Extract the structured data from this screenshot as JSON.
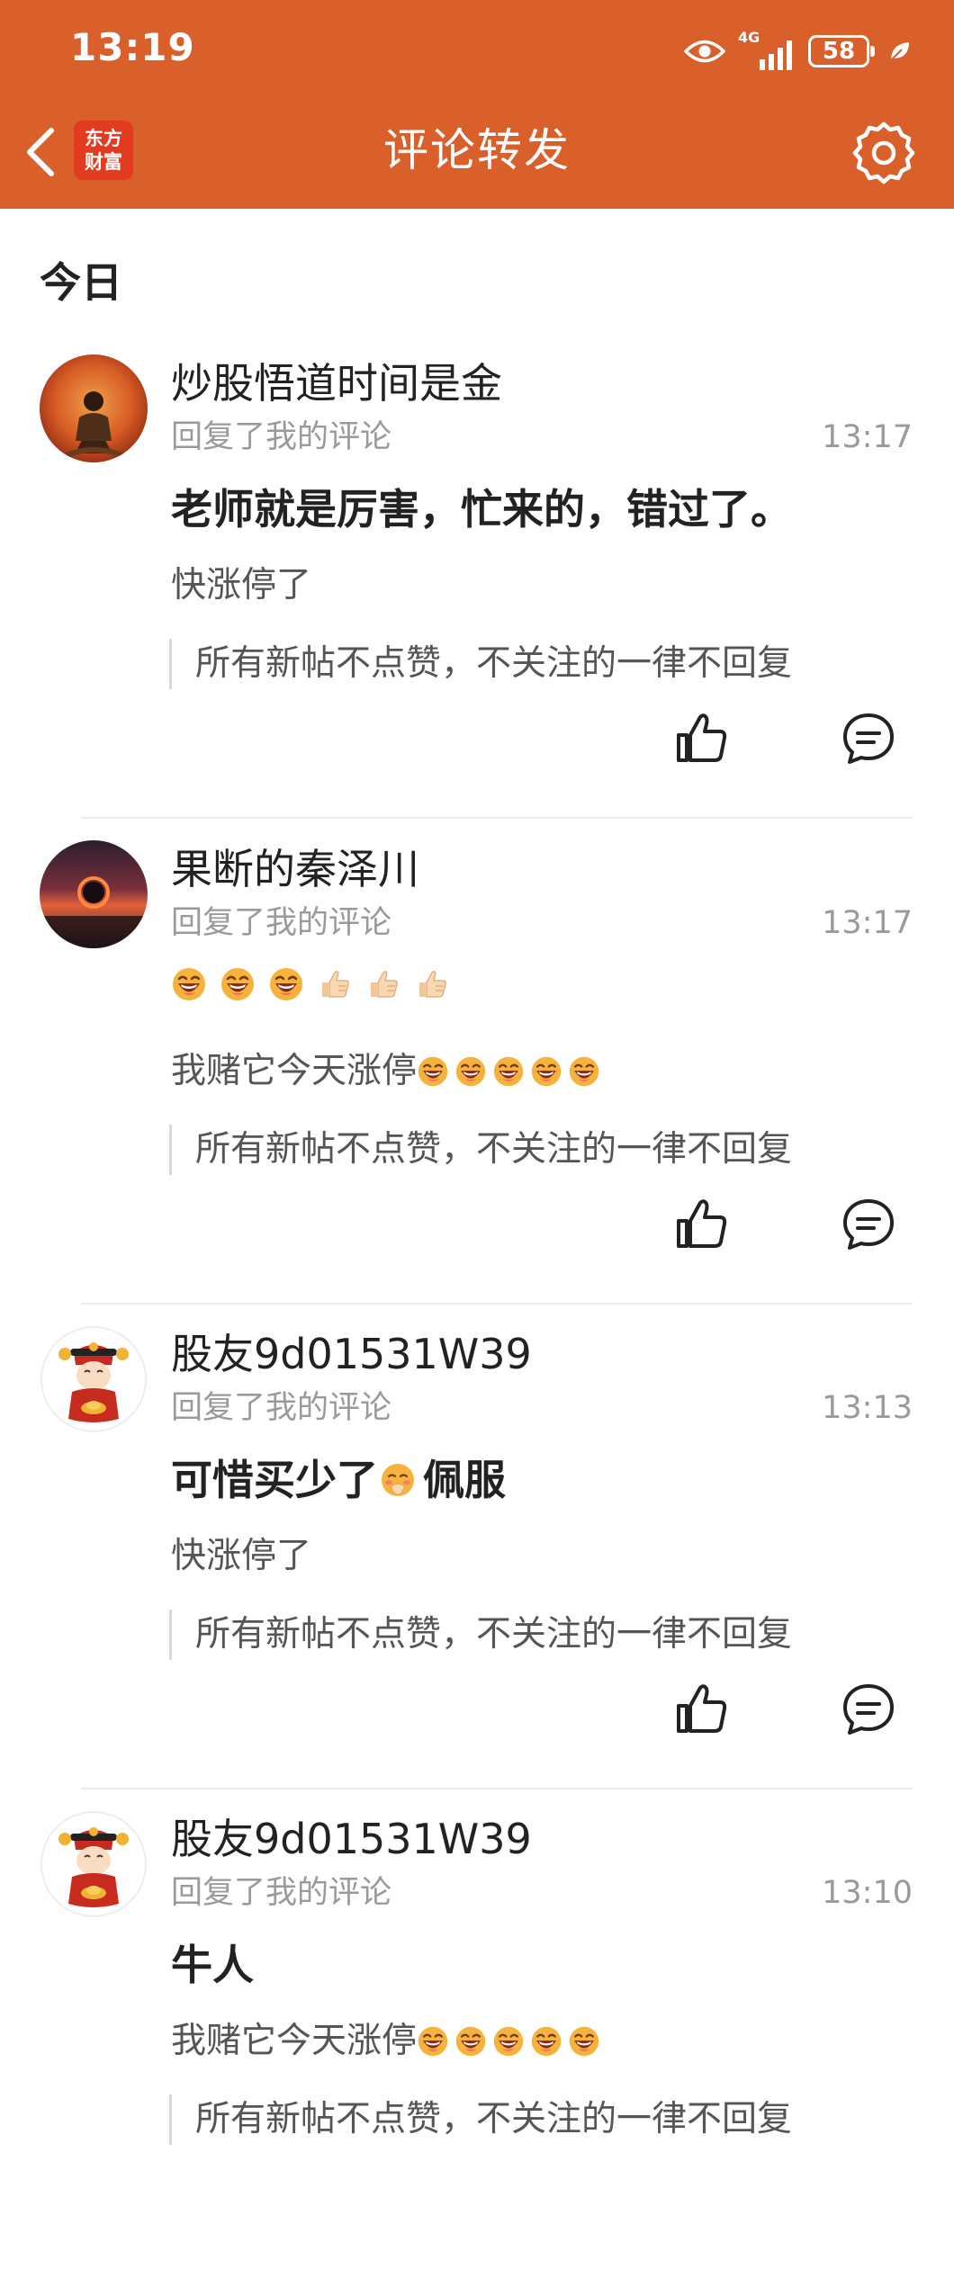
{
  "status_bar": {
    "time": "13:19",
    "network": "4G",
    "battery": "58",
    "icons": [
      "eye-icon",
      "signal-icon",
      "battery-icon",
      "leaf-icon"
    ]
  },
  "header": {
    "title": "评论转发",
    "logo_line1": "东方",
    "logo_line2": "财富",
    "back_icon": "chevron-left-icon",
    "settings_icon": "gear-icon"
  },
  "colors": {
    "header_bg": "#D95F2B",
    "text_primary": "#222222",
    "text_secondary": "#9A9A9A",
    "divider": "#ECECEC"
  },
  "section": {
    "label": "今日"
  },
  "notifications": [
    {
      "username": "炒股悟道时间是金",
      "meta_label": "回复了我的评论",
      "time": "13:17",
      "reply": "老师就是厉害，忙来的，错过了。",
      "my_comment": "快涨停了",
      "quote": "所有新帖不点赞，不关注的一律不回复",
      "avatar": "painting-avatar"
    },
    {
      "username": "果断的秦泽川",
      "meta_label": "回复了我的评论",
      "time": "13:17",
      "reply": "",
      "reply_emojis": [
        "laugh-emoji",
        "laugh-emoji",
        "laugh-emoji",
        "thumbs-up-emoji",
        "thumbs-up-emoji",
        "thumbs-up-emoji"
      ],
      "my_comment": "我赌它今天涨停",
      "my_comment_emojis": [
        "laugh-emoji",
        "laugh-emoji",
        "laugh-emoji",
        "laugh-emoji",
        "laugh-emoji"
      ],
      "quote": "所有新帖不点赞，不关注的一律不回复",
      "avatar": "eclipse-avatar"
    },
    {
      "username": "股友9d01531W39",
      "meta_label": "回复了我的评论",
      "time": "13:13",
      "reply_before": "可惜买少了",
      "reply_after": "佩服",
      "reply_emojis": [
        "shy-emoji"
      ],
      "my_comment": "快涨停了",
      "quote": "所有新帖不点赞，不关注的一律不回复",
      "avatar": "fortune-god-avatar"
    },
    {
      "username": "股友9d01531W39",
      "meta_label": "回复了我的评论",
      "time": "13:10",
      "reply": "牛人",
      "my_comment": "我赌它今天涨停",
      "my_comment_emojis": [
        "laugh-emoji",
        "laugh-emoji",
        "laugh-emoji",
        "laugh-emoji",
        "laugh-emoji"
      ],
      "quote": "所有新帖不点赞，不关注的一律不回复",
      "avatar": "fortune-god-avatar"
    }
  ]
}
